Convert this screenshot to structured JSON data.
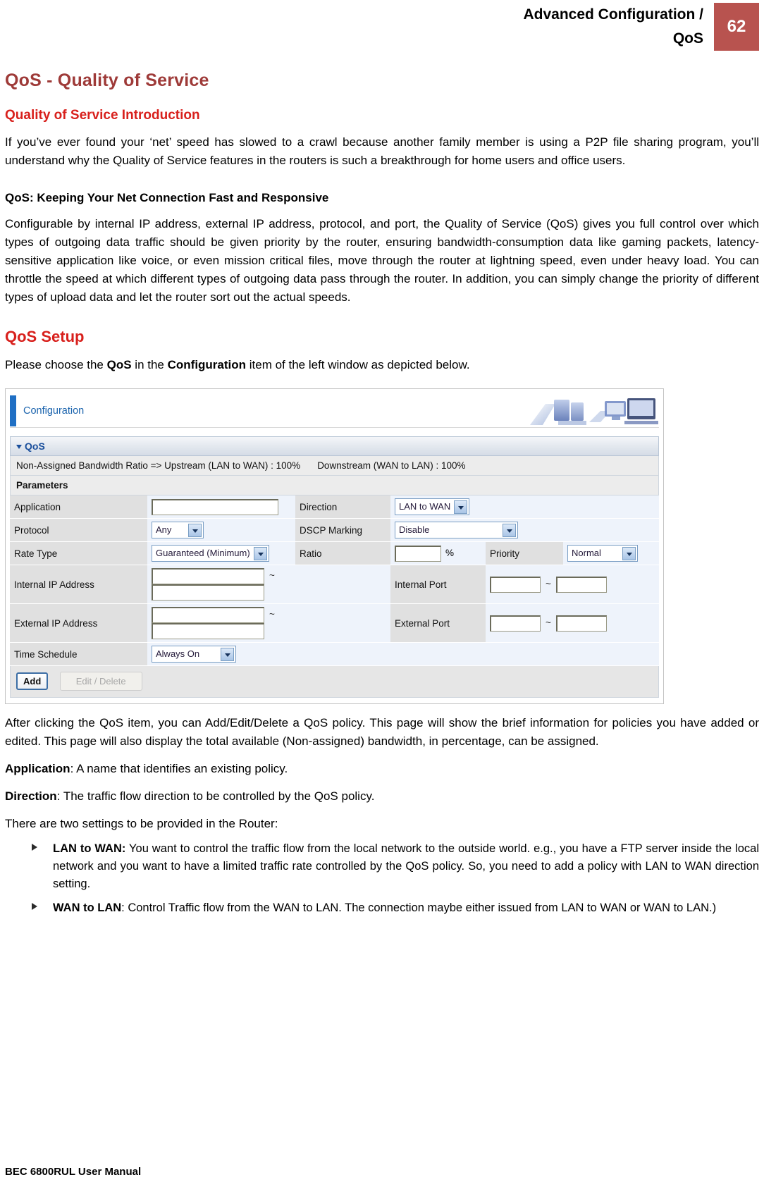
{
  "header": {
    "title": "Advanced Configuration /\nQoS",
    "page_number": "62",
    "accent_color": "#b8534f"
  },
  "section": {
    "title": "QoS - Quality of Service",
    "intro_heading": "Quality of Service Introduction",
    "intro_paragraph": "If you’ve ever found your ‘net’ speed has slowed to a crawl because another family member is using a P2P file sharing program, you’ll understand why the Quality of Service features in the routers is such a breakthrough for home users and office users.",
    "fast_heading": "QoS: Keeping Your Net Connection Fast and Responsive",
    "fast_paragraph": "Configurable by internal IP address, external IP address, protocol, and port, the Quality of Service (QoS) gives you full control over which types of outgoing data traffic should be given priority by the router, ensuring bandwidth-consumption data like gaming packets, latency-sensitive application like voice, or even mission critical files, move through the router at lightning speed, even under heavy load. You can throttle the speed at which different types of outgoing data pass through the router. In addition, you can simply change the priority of different types of upload data and let the router sort out the actual speeds.",
    "setup_heading": "QoS Setup",
    "setup_intro_prefix": "Please choose the ",
    "setup_intro_bold1": "QoS",
    "setup_intro_mid": " in the ",
    "setup_intro_bold2": "Configuration",
    "setup_intro_suffix": " item of the left window as depicted below."
  },
  "screenshot": {
    "breadcrumb": "Configuration",
    "panel_title": "QoS",
    "ratio_line": "Non-Assigned Bandwidth Ratio => Upstream (LAN to WAN) : 100%",
    "ratio_line2": "Downstream (WAN to LAN) : 100%",
    "parameters_label": "Parameters",
    "fields": {
      "application_label": "Application",
      "application_value": "",
      "direction_label": "Direction",
      "direction_value": "LAN to WAN",
      "protocol_label": "Protocol",
      "protocol_value": "Any",
      "dscp_label": "DSCP Marking",
      "dscp_value": "Disable",
      "rate_type_label": "Rate Type",
      "rate_type_value": "Guaranteed (Minimum)",
      "ratio_label": "Ratio",
      "ratio_value": "",
      "ratio_unit": "%",
      "priority_label": "Priority",
      "priority_value": "Normal",
      "internal_ip_label": "Internal IP Address",
      "internal_ip_from": "",
      "internal_ip_to": "",
      "internal_port_label": "Internal Port",
      "internal_port_from": "",
      "internal_port_to": "",
      "external_ip_label": "External IP Address",
      "external_ip_from": "",
      "external_ip_to": "",
      "external_port_label": "External Port",
      "external_port_from": "",
      "external_port_to": "",
      "time_schedule_label": "Time Schedule",
      "time_schedule_value": "Always On",
      "range_separator": "~"
    },
    "buttons": {
      "add": "Add",
      "edit_delete": "Edit / Delete"
    }
  },
  "after": {
    "paragraph": "After clicking the QoS item, you can Add/Edit/Delete a QoS policy. This page will show the brief information for policies you have added or edited. This page will also display the total available (Non-assigned) bandwidth, in percentage, can be assigned.",
    "application_term": "Application",
    "application_desc": ": A name that identifies an existing policy.",
    "direction_term": "Direction",
    "direction_desc": ": The traffic flow direction to be controlled by the QoS policy.",
    "two_settings": "There are two settings to be provided in the Router:",
    "bullets": [
      {
        "term": "LAN to WAN:",
        "text": " You want to control the traffic flow from the local network to the outside world. e.g., you have a FTP server inside the local network and you want to have a limited traffic rate controlled by the QoS policy. So, you need to add a policy with LAN to WAN direction setting."
      },
      {
        "term": "WAN to LAN",
        "text": ": Control Traffic flow from the WAN to LAN. The connection maybe either issued from LAN to WAN or WAN to LAN.)"
      }
    ]
  },
  "footer": {
    "text": "BEC 6800RUL User Manual"
  }
}
